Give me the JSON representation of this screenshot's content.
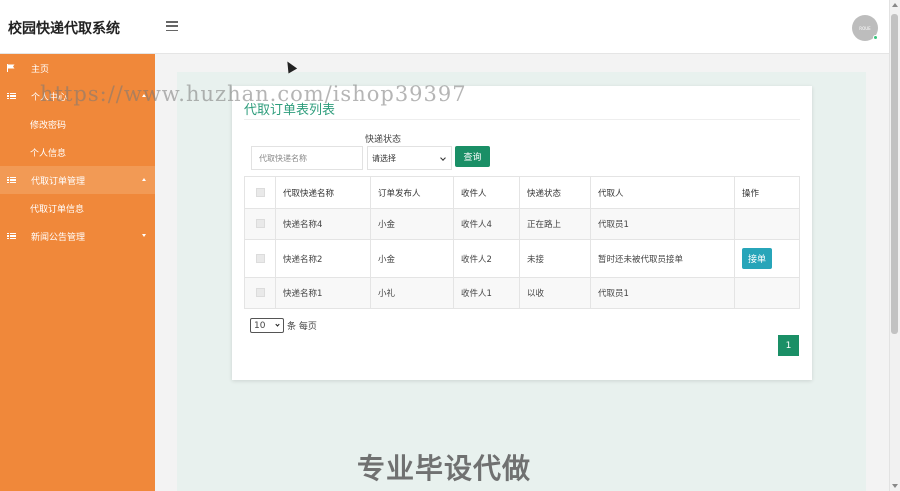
{
  "app": {
    "title": "校园快递代取系统",
    "avatar_text": "ROUE"
  },
  "sidebar": {
    "items": [
      {
        "label": "主页"
      },
      {
        "label": "个人中心"
      },
      {
        "label": "修改密码"
      },
      {
        "label": "个人信息"
      },
      {
        "label": "代取订单管理"
      },
      {
        "label": "代取订单信息"
      },
      {
        "label": "新闻公告管理"
      }
    ]
  },
  "card": {
    "title": "代取订单表列表",
    "filter": {
      "status_label": "快递状态",
      "name_placeholder": "代取快递名称",
      "status_selected": "请选择",
      "query_label": "查询"
    },
    "table": {
      "headers": [
        "代取快递名称",
        "订单发布人",
        "收件人",
        "快递状态",
        "代取人",
        "操作"
      ],
      "rows": [
        [
          "快递名称4",
          "小金",
          "收件人4",
          "正在路上",
          "代取员1",
          ""
        ],
        [
          "快递名称2",
          "小金",
          "收件人2",
          "未接",
          "暂时还未被代取员接单",
          "接单"
        ],
        [
          "快递名称1",
          "小礼",
          "收件人1",
          "以收",
          "代取员1",
          ""
        ]
      ]
    },
    "pagination": {
      "page_size": "10",
      "page_size_suffix": "条 每页",
      "current_page": "1"
    }
  },
  "watermarks": {
    "url": "https://www.huzhan.com/ishop39397",
    "bottom": "专业毕设代做"
  },
  "colors": {
    "sidebar": "#f0883a",
    "accent_green": "#1a8f66",
    "title_green": "#2e9d7c",
    "accept_button": "#27a5b9"
  }
}
